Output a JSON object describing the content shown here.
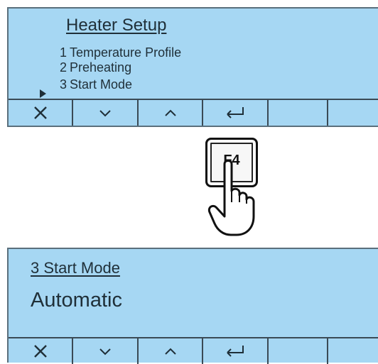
{
  "screen1": {
    "title": "Heater Setup",
    "items": [
      {
        "num": "1",
        "label": "Temperature Profile"
      },
      {
        "num": "2",
        "label": "Preheating"
      },
      {
        "num": "3",
        "label": "Start Mode"
      }
    ],
    "selected_index": 2,
    "softkeys": [
      {
        "symbol": "✕",
        "icon": "close-icon"
      },
      {
        "symbol": "⌄",
        "icon": "chevron-down-icon"
      },
      {
        "symbol": "^",
        "icon": "chevron-up-icon"
      },
      {
        "symbol": "↵",
        "icon": "enter-icon"
      },
      {
        "symbol": "",
        "icon": ""
      },
      {
        "symbol": "",
        "icon": ""
      }
    ]
  },
  "key": {
    "label": "F4",
    "icon": "pointing-hand-icon"
  },
  "screen2": {
    "title": "3 Start Mode",
    "value": "Automatic",
    "softkeys": [
      {
        "symbol": "✕",
        "icon": "close-icon"
      },
      {
        "symbol": "⌄",
        "icon": "chevron-down-icon"
      },
      {
        "symbol": "^",
        "icon": "chevron-up-icon"
      },
      {
        "symbol": "↵",
        "icon": "enter-icon"
      },
      {
        "symbol": "",
        "icon": ""
      },
      {
        "symbol": "",
        "icon": ""
      }
    ]
  },
  "colors": {
    "lcd_background": "#a6d7f3",
    "lcd_text": "#1f2f38"
  }
}
